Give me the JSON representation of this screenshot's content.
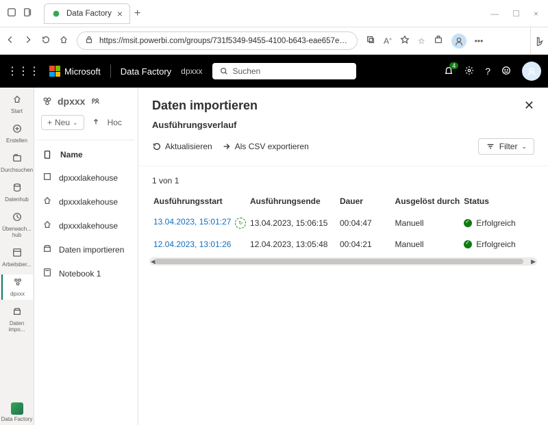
{
  "browser": {
    "tab_title": "Data Factory",
    "url": "https://msit.powerbi.com/groups/731f5349-9455-4100-b643-eae657e298..."
  },
  "app": {
    "brand": "Microsoft",
    "product": "Data Factory",
    "workspace": "dpxxx",
    "search_placeholder": "Suchen",
    "notif_count": "4"
  },
  "rail": {
    "items": [
      {
        "label": "Start"
      },
      {
        "label": "Erstellen"
      },
      {
        "label": "Durchsuchen"
      },
      {
        "label": "Datenhub"
      },
      {
        "label": "Überwach... hub"
      },
      {
        "label": "Arbeitsber..."
      },
      {
        "label": "dpxxx"
      },
      {
        "label": "Daten impo..."
      }
    ],
    "footer": "Data Factory"
  },
  "leftpane": {
    "title": "dpxxx",
    "new_label": "Neu",
    "upload_label": "Hoc",
    "name_header": "Name",
    "rows": [
      {
        "label": "dpxxxlakehouse"
      },
      {
        "label": "dpxxxlakehouse"
      },
      {
        "label": "dpxxxlakehouse"
      },
      {
        "label": "Daten importieren"
      },
      {
        "label": "Notebook 1"
      }
    ]
  },
  "main": {
    "title": "Daten importieren",
    "section": "Ausführungsverlauf",
    "refresh": "Aktualisieren",
    "export_csv": "Als CSV exportieren",
    "filter": "Filter",
    "count": "1 von 1",
    "cols": {
      "start": "Ausführungsstart",
      "end": "Ausführungsende",
      "duration": "Dauer",
      "trigger": "Ausgelöst durch",
      "status": "Status"
    },
    "rows": [
      {
        "start": "13.04.2023, 15:01:27",
        "running": true,
        "end": "13.04.2023, 15:06:15",
        "dur": "00:04:47",
        "trig": "Manuell",
        "status": "Erfolgreich"
      },
      {
        "start": "12.04.2023, 13:01:26",
        "running": false,
        "end": "12.04.2023, 13:05:48",
        "dur": "00:04:21",
        "trig": "Manuell",
        "status": "Erfolgreich"
      }
    ]
  }
}
